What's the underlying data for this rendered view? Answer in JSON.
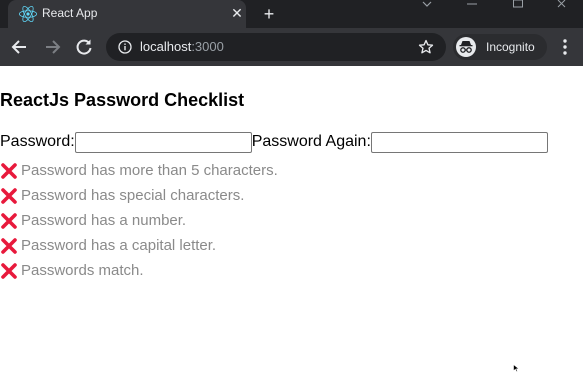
{
  "browser": {
    "tab_title": "React App",
    "tab_close_glyph": "✕",
    "new_tab_glyph": "+",
    "url_host": "localhost",
    "url_port": ":3000",
    "profile_label": "Incognito",
    "icons": [
      "react-favicon-icon",
      "back-icon",
      "forward-icon",
      "reload-icon",
      "info-icon",
      "star-icon",
      "incognito-icon",
      "menu-icon"
    ]
  },
  "page": {
    "title": "ReactJs Password Checklist",
    "password_label": "Password:",
    "password_value": "",
    "password_again_label": "Password Again:",
    "password_again_value": "",
    "checklist": [
      "Password has more than 5 characters.",
      "Password has special characters.",
      "Password has a number.",
      "Password has a capital letter.",
      "Passwords match."
    ],
    "invalid_color": "#e8193c",
    "invalid_text_color": "#8a8a8a"
  }
}
